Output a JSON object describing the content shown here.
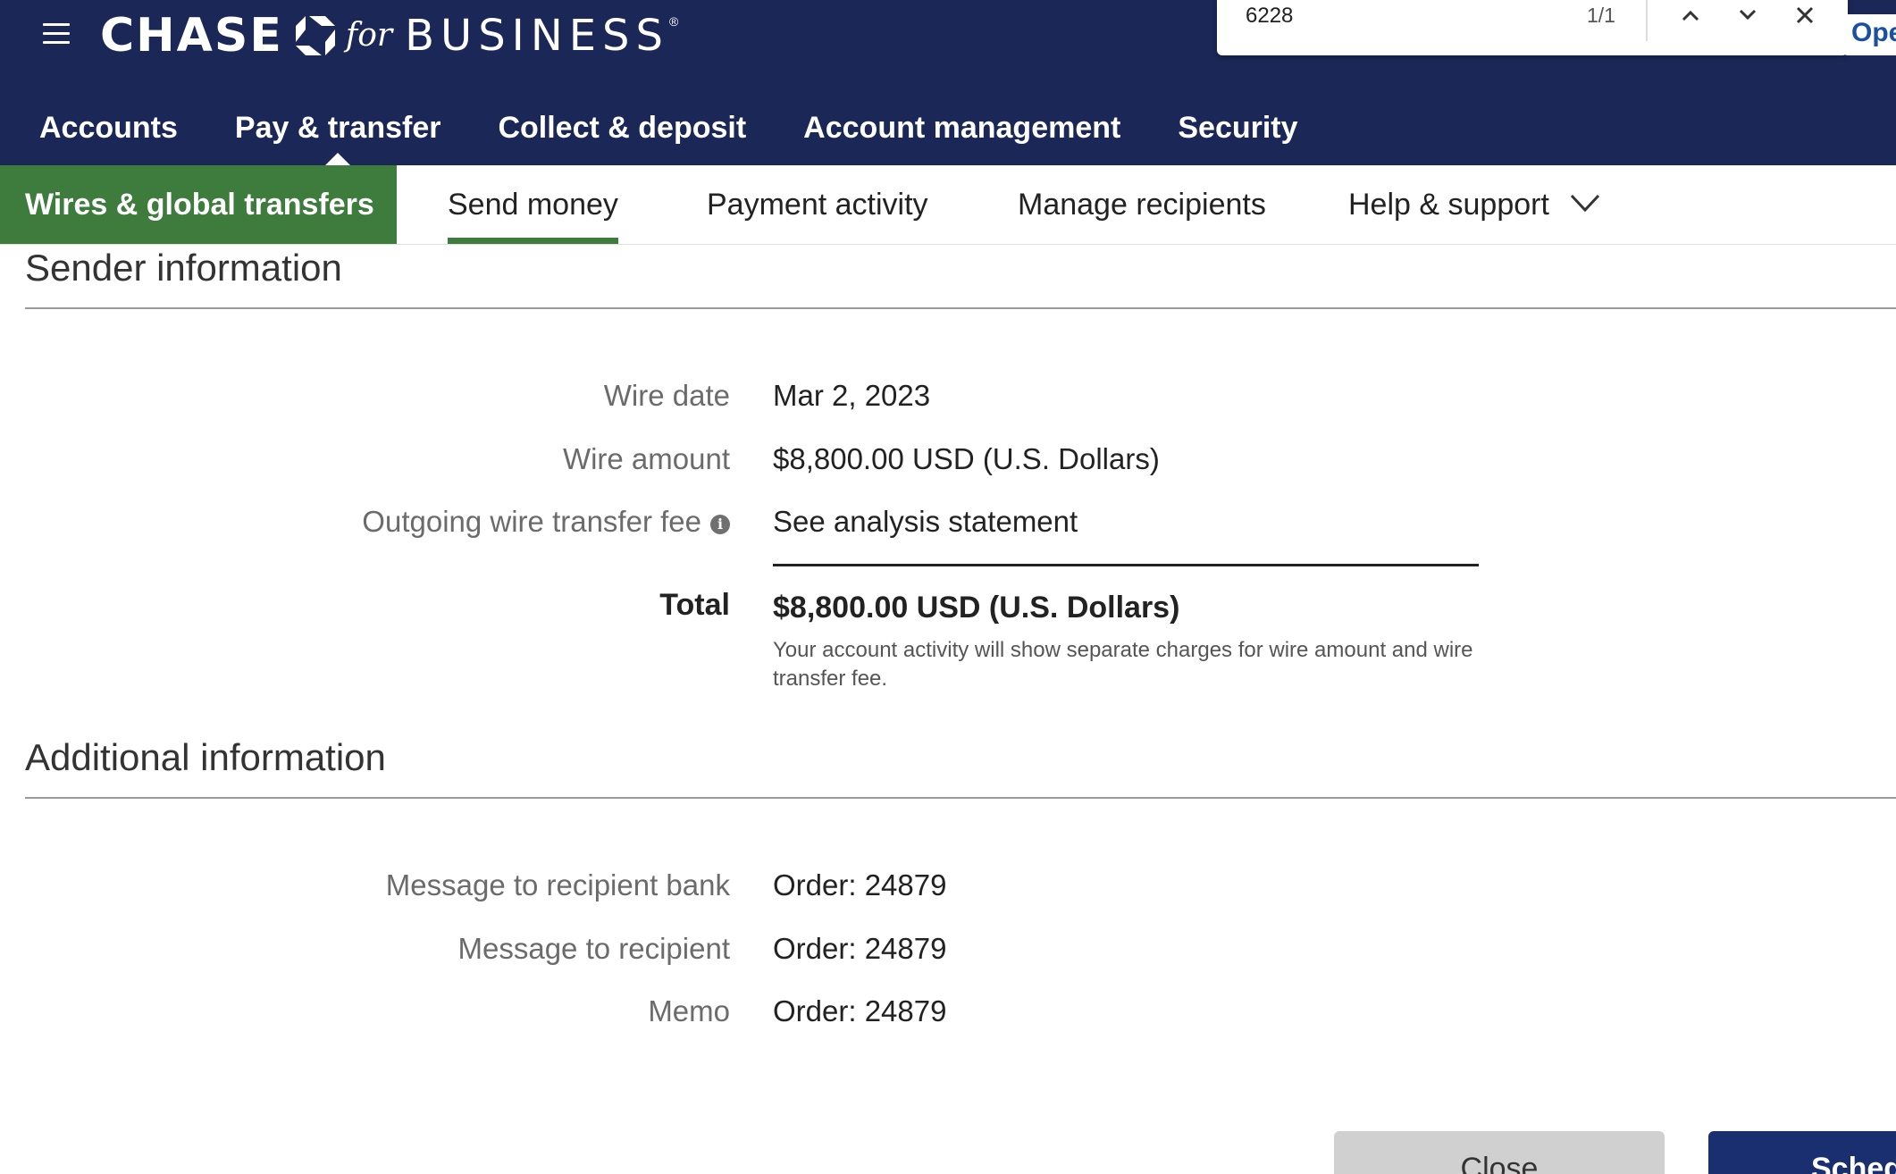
{
  "header": {
    "logo_main": "CHASE",
    "logo_for": "for",
    "logo_business": "BUSINESS",
    "logo_reg": "®",
    "nav": [
      {
        "label": "Accounts"
      },
      {
        "label": "Pay & transfer",
        "active": true
      },
      {
        "label": "Collect & deposit"
      },
      {
        "label": "Account management"
      },
      {
        "label": "Security"
      }
    ]
  },
  "findbar": {
    "query": "6228",
    "count": "1/1",
    "open_label": "Open"
  },
  "subnav": {
    "section": "Wires & global transfers",
    "tabs": [
      {
        "label": "Send money",
        "active": true
      },
      {
        "label": "Payment activity"
      },
      {
        "label": "Manage recipients"
      },
      {
        "label": "Help & support"
      }
    ]
  },
  "sender": {
    "title": "Sender information",
    "rows": [
      {
        "label": "Wire date",
        "value": "Mar 2, 2023"
      },
      {
        "label": "Wire amount",
        "value": "$8,800.00 USD (U.S. Dollars)"
      },
      {
        "label": "Outgoing wire transfer fee",
        "value": "See analysis statement"
      }
    ],
    "total_label": "Total",
    "total_value": "$8,800.00  USD (U.S. Dollars)",
    "total_note": "Your account activity will show separate charges for wire amount and wire transfer fee."
  },
  "additional": {
    "title": "Additional information",
    "rows": [
      {
        "label": "Message to recipient bank",
        "value": "Order: 24879"
      },
      {
        "label": "Message to recipient",
        "value": "Order: 24879"
      },
      {
        "label": "Memo",
        "value": "Order: 24879"
      }
    ]
  },
  "actions": {
    "close_label": "Close",
    "schedule_label": "Schedule"
  },
  "colors": {
    "header_bg": "#1a2757",
    "section_green": "#3d7c3d",
    "primary_button": "#1a2f6f"
  }
}
